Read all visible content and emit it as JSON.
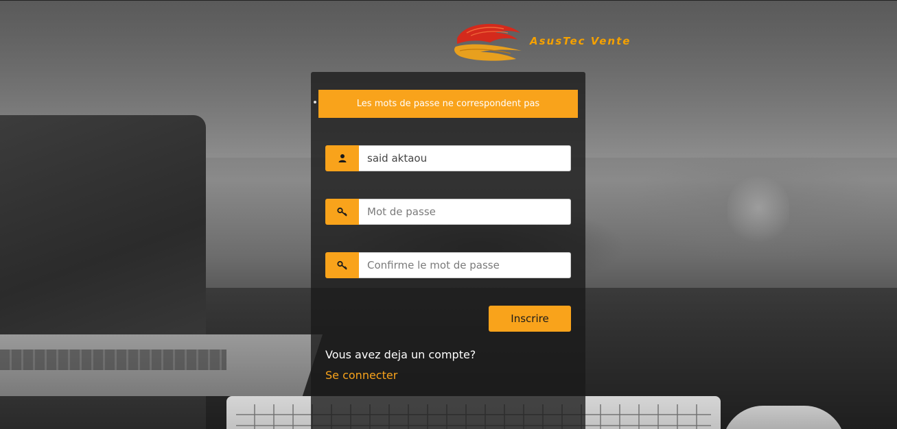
{
  "brand": {
    "name": "AsusTec Vente",
    "logo_icon": "asustec-logo-icon",
    "accent_color": "#f9a31b"
  },
  "alert": {
    "message": "Les mots de passe ne correspondent pas"
  },
  "form": {
    "username": {
      "icon": "user-icon",
      "value": "said aktaou",
      "placeholder": ""
    },
    "password": {
      "icon": "key-icon",
      "value": "",
      "placeholder": "Mot de passe"
    },
    "confirm_password": {
      "icon": "key-icon",
      "value": "",
      "placeholder": "Confirme le mot de passe"
    },
    "submit_label": "Inscrire"
  },
  "footer": {
    "question": "Vous avez deja un compte?",
    "login_link": "Se connecter"
  }
}
